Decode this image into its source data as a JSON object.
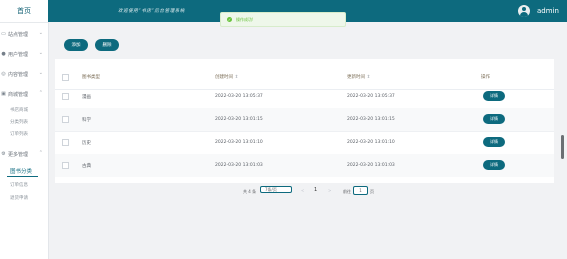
{
  "sidebar": {
    "home": "首页",
    "menus": [
      {
        "label": "站点管理",
        "icon": "▭"
      },
      {
        "label": "用户管理",
        "icon": "●"
      },
      {
        "label": "内容管理",
        "icon": "◎"
      },
      {
        "label": "商城管理",
        "icon": "▣"
      }
    ],
    "shop_sub": [
      "书店商城",
      "分类列表",
      "订单列表"
    ],
    "more": {
      "label": "更多管理",
      "icon": "⚙"
    },
    "active": "图书分类",
    "after_active": [
      "订单信息",
      "退货申请"
    ]
  },
  "header": {
    "welcome": "欢迎使用“书店”后台管理系统",
    "user": "admin"
  },
  "toast": {
    "message": "操作成功!"
  },
  "toolbar": {
    "add": "添加",
    "delete": "删除"
  },
  "table": {
    "columns": {
      "type": "图书类型",
      "created": "创建时间",
      "updated": "更新时间",
      "action": "操作"
    },
    "sort_mark": "⇕",
    "rows": [
      {
        "type": "漫画",
        "created": "2022-03-20 13:05:37",
        "updated": "2022-03-20 13:05:37"
      },
      {
        "type": "科学",
        "created": "2022-03-20 13:01:15",
        "updated": "2022-03-20 13:01:15"
      },
      {
        "type": "历史",
        "created": "2022-03-20 13:01:10",
        "updated": "2022-03-20 13:01:10"
      },
      {
        "type": "古典",
        "created": "2022-03-20 13:01:03",
        "updated": "2022-03-20 13:01:03"
      }
    ],
    "detail_label": "详情"
  },
  "pagination": {
    "total": "共 4 条",
    "page_size": "7条/页",
    "prev": "<",
    "current": "1",
    "next": ">",
    "goto": "前往",
    "goto_value": "1",
    "unit": "页"
  }
}
